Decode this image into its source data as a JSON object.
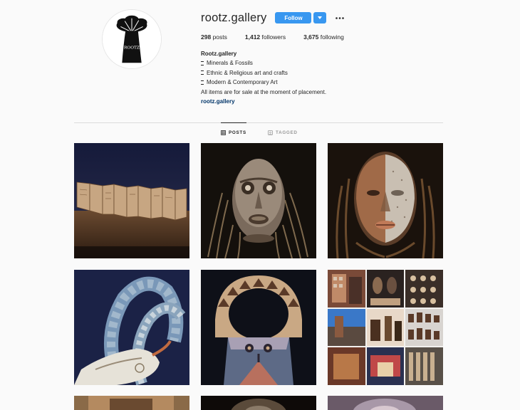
{
  "profile": {
    "username": "rootz.gallery",
    "follow_label": "Follow",
    "avatar_icon": "baobab-tree-logo",
    "avatar_text": "ROOTZ",
    "stats": {
      "posts_count": "298",
      "posts_label": "posts",
      "followers_count": "1,412",
      "followers_label": "followers",
      "following_count": "3,675",
      "following_label": "following"
    },
    "bio": {
      "name": "Rootz.gallery",
      "lines": [
        "Minerals & Fossils",
        "Ethnic & Religious art and crafts",
        "Modern & Contemporary Art"
      ],
      "note": "All items are for sale at the moment of placement.",
      "link": "rootz.gallery"
    }
  },
  "tabs": [
    {
      "label": "POSTS",
      "icon": "grid-icon",
      "active": true
    },
    {
      "label": "TAGGED",
      "icon": "tag-icon",
      "active": false
    }
  ],
  "posts": [
    {
      "subject": "folded-manuscript"
    },
    {
      "subject": "african-mask-raffia"
    },
    {
      "subject": "african-mask-half-white"
    },
    {
      "subject": "horned-headdress-mask"
    },
    {
      "subject": "arched-mask"
    },
    {
      "subject": "gallery-collage"
    },
    {
      "subject": "partial-1"
    },
    {
      "subject": "partial-2"
    },
    {
      "subject": "partial-3"
    }
  ],
  "colors": {
    "accent": "#3897f0",
    "link": "#003569",
    "background": "#fafafa"
  }
}
